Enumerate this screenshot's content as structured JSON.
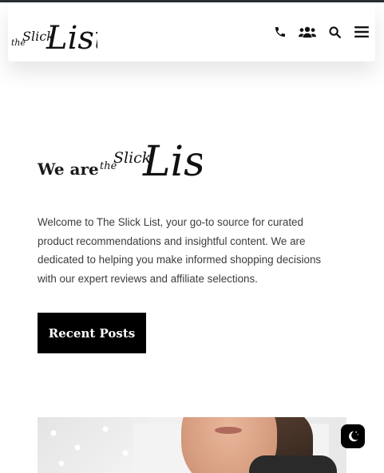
{
  "brand": {
    "logo_small": "the",
    "logo_mid": "Slick",
    "logo_big": "List"
  },
  "header": {
    "icons": [
      "phone-icon",
      "users-icon",
      "search-icon",
      "menu-icon"
    ]
  },
  "hero": {
    "prefix": "We are",
    "intro": "Welcome to The Slick List, your go-to source for curated product recommendations and insightful content. We are dedicated to helping you make informed shopping decisions with our expert reviews and affiliate selections.",
    "button_label": "Recent Posts"
  },
  "floating": {
    "toggle_icon": "moon-stars-icon"
  },
  "colors": {
    "text": "#1a1a1a",
    "body_text": "#3c3c3c",
    "button_bg": "#000000",
    "top_bar": "#2b2f33"
  }
}
